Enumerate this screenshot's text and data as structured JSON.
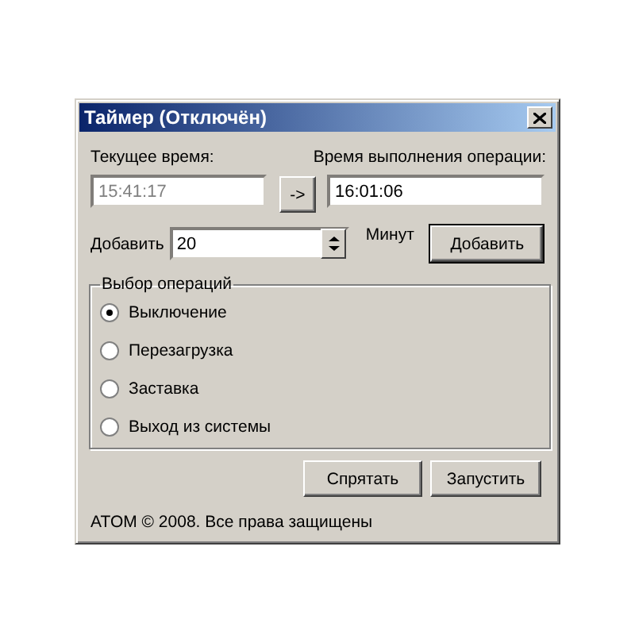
{
  "window": {
    "title": "Таймер (Отключён)"
  },
  "current_time": {
    "label": "Текущее время:",
    "value": "15:41:17",
    "disabled": true
  },
  "transfer_button": "->",
  "run_time": {
    "label": "Время выполнения операции:",
    "value": "16:01:06"
  },
  "add": {
    "label": "Добавить",
    "value": "20",
    "unit": "Минут",
    "button": "Добавить"
  },
  "operations": {
    "title": "Выбор операций",
    "options": [
      {
        "label": "Выключение",
        "selected": true
      },
      {
        "label": "Перезагрузка",
        "selected": false
      },
      {
        "label": "Заставка",
        "selected": false
      },
      {
        "label": "Выход из системы",
        "selected": false
      }
    ]
  },
  "buttons": [
    "Спрятать",
    "Запустить"
  ],
  "footer": "ATOM © 2008. Все права защищены"
}
